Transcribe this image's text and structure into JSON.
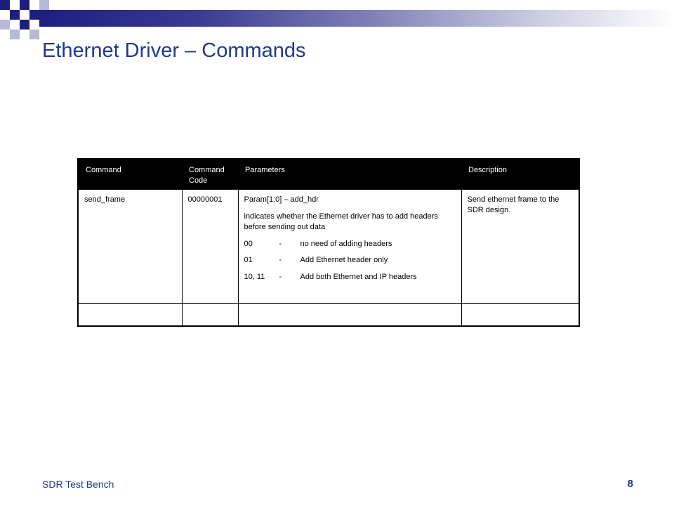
{
  "slide": {
    "title": "Ethernet Driver – Commands"
  },
  "table": {
    "headers": [
      "Command",
      "Command Code",
      "Parameters",
      "Description"
    ],
    "rows": [
      {
        "command": "send_frame",
        "code": "00000001",
        "param_name": "Param[1:0] – add_hdr",
        "param_desc": "indicates whether the Ethernet driver has to add headers before sending out data",
        "options": [
          {
            "code": "00",
            "dash": "-",
            "text": "no need of adding headers"
          },
          {
            "code": "01",
            "dash": "-",
            "text": "Add Ethernet header only"
          },
          {
            "code": "10, 11",
            "dash": "-",
            "text": "Add both Ethernet and IP headers"
          }
        ],
        "description": "Send ethernet frame to the SDR design."
      }
    ]
  },
  "footer": {
    "left": "SDR Test Bench",
    "page_number": "8"
  },
  "colors": {
    "title": "#1f3a8a",
    "header_dark": "#1e1e80",
    "table_header_bg": "#000000"
  }
}
